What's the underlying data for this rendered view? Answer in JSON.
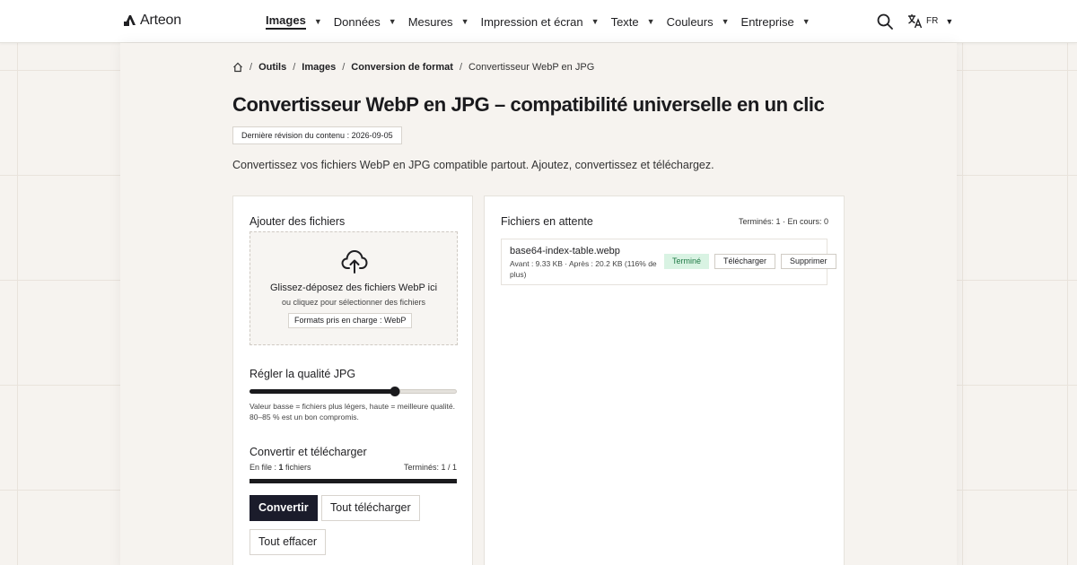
{
  "header": {
    "logo_text": "Arteon",
    "nav": [
      {
        "label": "Images",
        "active": true
      },
      {
        "label": "Données"
      },
      {
        "label": "Mesures"
      },
      {
        "label": "Impression et écran"
      },
      {
        "label": "Texte"
      },
      {
        "label": "Couleurs"
      },
      {
        "label": "Entreprise"
      }
    ],
    "search_icon": "search-icon",
    "language": {
      "icon": "translate-icon",
      "code": "FR"
    }
  },
  "breadcrumb": {
    "home_icon": "home-icon",
    "items": [
      "Outils",
      "Images",
      "Conversion de format"
    ],
    "current": "Convertisseur WebP en JPG"
  },
  "page": {
    "title": "Convertisseur WebP en JPG – compatibilité universelle en un clic",
    "revision": "Dernière révision du contenu : 2026-09-05",
    "intro": "Convertissez vos fichiers WebP en JPG compatible partout. Ajoutez, convertissez et téléchargez."
  },
  "upload": {
    "heading": "Ajouter des fichiers",
    "icon": "cloud-upload-icon",
    "dropzone_main": "Glissez-déposez des fichiers WebP ici",
    "dropzone_sub": "ou cliquez pour sélectionner des fichiers",
    "formats": "Formats pris en charge : WebP"
  },
  "quality": {
    "heading": "Régler la qualité JPG",
    "value_fraction": 0.7,
    "hint": "Valeur basse = fichiers plus légers, haute = meilleure qualité. 80–85 % est un bon compromis."
  },
  "convert": {
    "heading": "Convertir et télécharger",
    "queue_prefix": "En file : ",
    "queue_count": "1",
    "queue_suffix": " fichiers",
    "done_label": "Terminés: 1 / 1",
    "progress_fraction": 1.0,
    "convert_button": "Convertir",
    "download_all_button": "Tout télécharger",
    "clear_all_button": "Tout effacer"
  },
  "pending": {
    "heading": "Fichiers en attente",
    "status": "Terminés: 1 · En cours: 0",
    "files": [
      {
        "name": "base64-index-table.webp",
        "meta": "Avant : 9.33 KB · Après : 20.2 KB (116% de plus)",
        "badge": "Terminé",
        "download_label": "Télécharger",
        "delete_label": "Supprimer"
      }
    ]
  },
  "colors": {
    "accent": "#1b1c2b",
    "success_bg": "#d9f3e3",
    "success_text": "#1e7a45"
  }
}
